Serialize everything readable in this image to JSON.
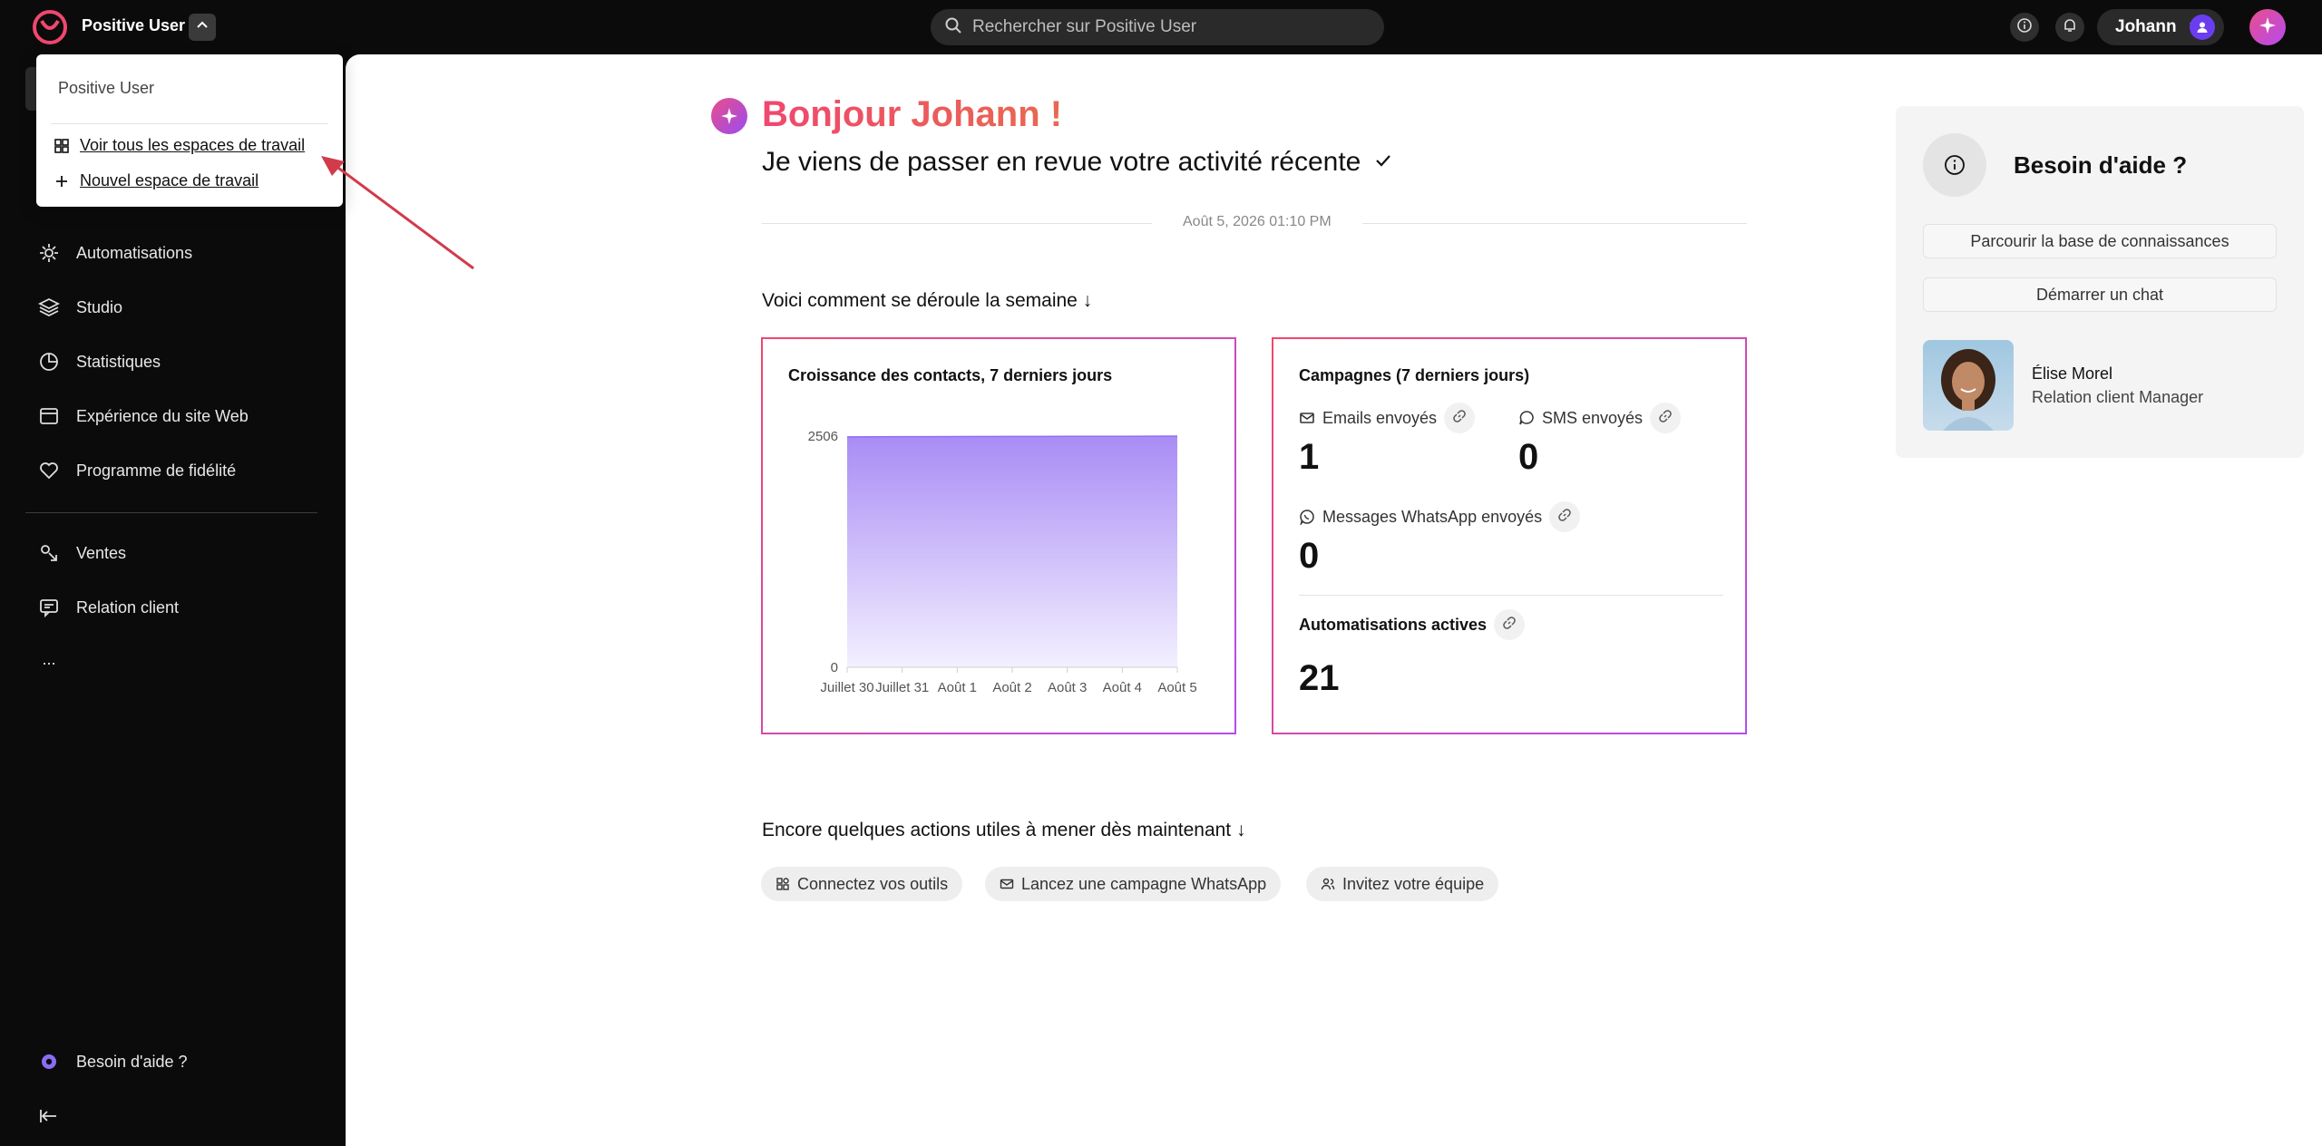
{
  "topbar": {
    "workspace_name": "Positive User",
    "search_placeholder": "Rechercher sur Positive User",
    "user_name": "Johann"
  },
  "workspace_menu": {
    "header": "Positive User",
    "items": [
      {
        "label": "Voir tous les espaces de travail",
        "icon": "grid-icon"
      },
      {
        "label": "Nouvel espace de travail",
        "icon": "plus-icon"
      }
    ]
  },
  "sidebar": {
    "items": [
      {
        "label": "Automatisations",
        "icon": "automation-icon"
      },
      {
        "label": "Studio",
        "icon": "layers-icon"
      },
      {
        "label": "Statistiques",
        "icon": "pie-chart-icon"
      },
      {
        "label": "Expérience du site Web",
        "icon": "browser-icon"
      },
      {
        "label": "Programme de fidélité",
        "icon": "heart-tag-icon"
      },
      {
        "label": "Ventes",
        "icon": "sales-icon"
      },
      {
        "label": "Relation client",
        "icon": "chat-support-icon"
      },
      {
        "label": "...",
        "icon": "more-icon"
      }
    ],
    "help_label": "Besoin d'aide ?",
    "collapse_icon": "collapse-sidebar-icon"
  },
  "main": {
    "greeting": "Bonjour Johann !",
    "subgreeting": "Je viens de passer en revue votre activité récente",
    "date": "Août 5, 2026 01:10 PM",
    "week_section_title": "Voici comment se déroule la semaine ↓",
    "actions_section_title": "Encore quelques actions utiles à mener dès maintenant ↓",
    "actions": [
      {
        "label": "Connectez vos outils",
        "icon": "apps-icon"
      },
      {
        "label": "Lancez une campagne WhatsApp",
        "icon": "mail-icon"
      },
      {
        "label": "Invitez votre équipe",
        "icon": "users-icon"
      }
    ]
  },
  "contacts_card": {
    "title": "Croissance des contacts, 7 derniers jours"
  },
  "campaigns_card": {
    "title": "Campagnes (7 derniers jours)",
    "emails_label": "Emails envoyés",
    "emails_value": "1",
    "sms_label": "SMS envoyés",
    "sms_value": "0",
    "whatsapp_label": "Messages WhatsApp envoyés",
    "whatsapp_value": "0",
    "automations_label": "Automatisations actives",
    "automations_value": "21"
  },
  "help_panel": {
    "title": "Besoin d'aide ?",
    "knowledge_button": "Parcourir la base de connaissances",
    "chat_button": "Démarrer un chat",
    "agent_name": "Élise Morel",
    "agent_role": "Relation client Manager"
  },
  "chart_data": {
    "type": "area",
    "title": "Croissance des contacts, 7 derniers jours",
    "categories": [
      "Juillet 30",
      "Juillet 31",
      "Août 1",
      "Août 2",
      "Août 3",
      "Août 4",
      "Août 5"
    ],
    "series": [
      {
        "values": [
          2498,
          2500,
          2501,
          2502,
          2503,
          2504,
          2506
        ]
      }
    ],
    "yticks": [
      0,
      2506
    ],
    "ylim": [
      0,
      2506
    ],
    "colors": {
      "fill_top": "#a98cf5",
      "fill_bottom": "#f3f0ff"
    }
  },
  "colors": {
    "accent_red": "#f0476e",
    "accent_purple": "#b44cf0"
  }
}
